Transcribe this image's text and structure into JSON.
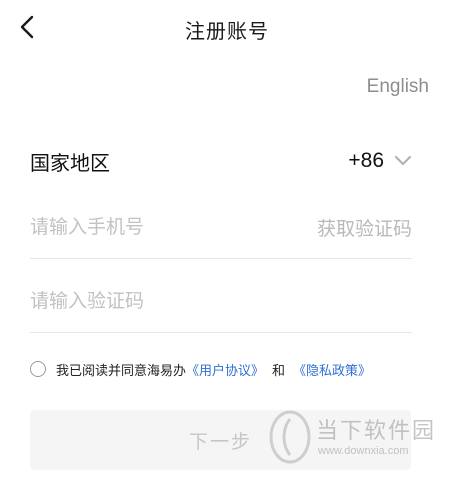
{
  "header": {
    "back_icon": "chevron-left-icon",
    "title": "注册账号"
  },
  "language_link": "English",
  "form": {
    "country": {
      "label": "国家地区",
      "code": "+86",
      "dropdown_icon": "chevron-down-icon"
    },
    "phone": {
      "placeholder": "请输入手机号",
      "value": "",
      "get_code_label": "获取验证码"
    },
    "verify_code": {
      "placeholder": "请输入验证码",
      "value": ""
    }
  },
  "agreement": {
    "checked": false,
    "prefix": "我已阅读并同意海易办",
    "user_agreement": "《用户协议》",
    "and": "和",
    "privacy_policy": "《隐私政策》"
  },
  "next_button_label": "下一步",
  "watermark": {
    "text": "当下软件园",
    "url": "www.downxia.com"
  },
  "colors": {
    "link": "#2f6fd6",
    "placeholder": "#c2c2c2",
    "button_bg": "#f5f5f5",
    "button_text": "#c6c6c6"
  }
}
